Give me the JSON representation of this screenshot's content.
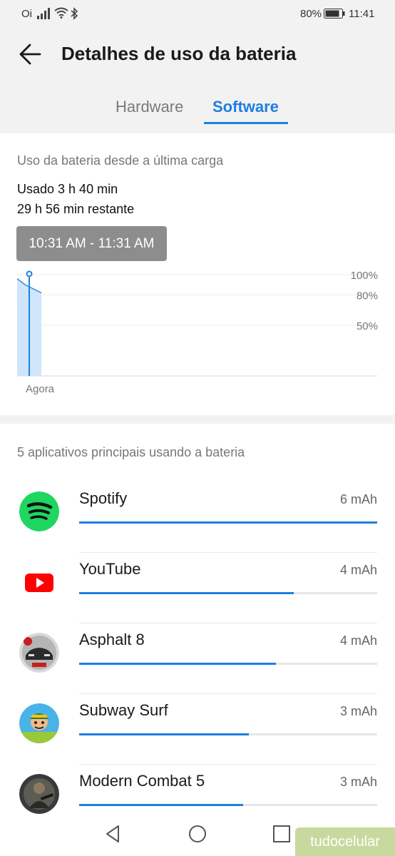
{
  "status_bar": {
    "carrier": "Oi",
    "battery_pct": "80%",
    "time": "11:41"
  },
  "header": {
    "title": "Detalhes de uso da bateria"
  },
  "tabs": [
    {
      "label": "Hardware",
      "selected": false
    },
    {
      "label": "Software",
      "selected": true
    }
  ],
  "usage": {
    "section_label": "Uso da bateria desde a última carga",
    "used": "Usado 3 h 40 min",
    "remaining": "29 h 56 min restante",
    "tooltip": "10:31 AM - 11:31 AM"
  },
  "chart_data": {
    "type": "area",
    "y_tick_labels": [
      "100%",
      "80%",
      "50%"
    ],
    "x_label": "Agora",
    "ylim": [
      0,
      100
    ],
    "series": [
      {
        "values": [
          96,
          93,
          90,
          88,
          86,
          84,
          82
        ]
      }
    ]
  },
  "apps": {
    "section_label": "5 aplicativos principais usando a bateria",
    "items": [
      {
        "name": "Spotify",
        "usage": "6 mAh",
        "fraction": 1.0
      },
      {
        "name": "YouTube",
        "usage": "4 mAh",
        "fraction": 0.72
      },
      {
        "name": "Asphalt 8",
        "usage": "4 mAh",
        "fraction": 0.66
      },
      {
        "name": "Subway Surf",
        "usage": "3 mAh",
        "fraction": 0.57
      },
      {
        "name": "Modern Combat 5",
        "usage": "3 mAh",
        "fraction": 0.55
      }
    ]
  },
  "watermark": "tudocelular",
  "colors": {
    "accent": "#1e7fe0",
    "spotify": "#1ed760",
    "youtube": "#ff0000"
  }
}
